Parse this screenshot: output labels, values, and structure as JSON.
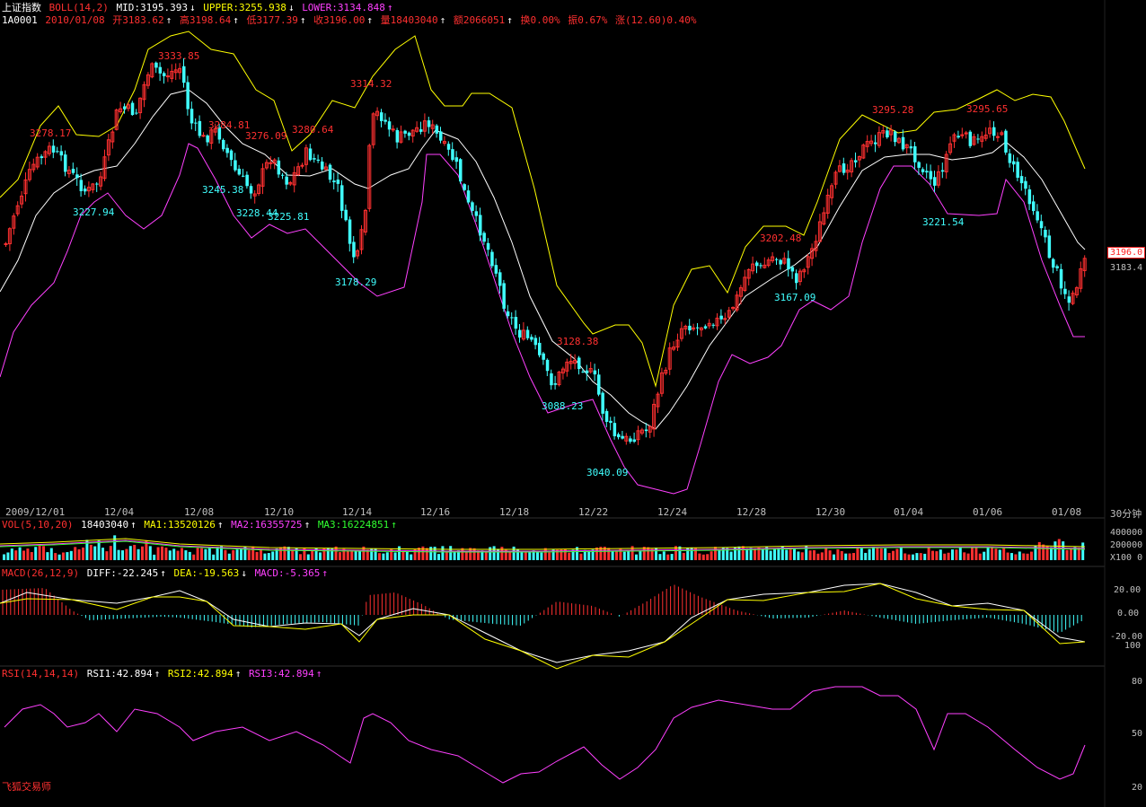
{
  "window": {
    "index_name": "上证指数",
    "code": "1A0001",
    "watermark": "飞狐交易师"
  },
  "boll": {
    "label": "BOLL(14,2)",
    "mid": "MID:3195.393",
    "mid_arrow": "↓",
    "upper": "UPPER:3255.938",
    "upper_arrow": "↓",
    "lower": "LOWER:3134.848",
    "lower_arrow": "↑"
  },
  "bar_info": {
    "date": "2010/01/08",
    "open": "开3183.62",
    "open_arrow": "↑",
    "high": "高3198.64",
    "high_arrow": "↑",
    "low": "低3177.39",
    "low_arrow": "↑",
    "close": "收3196.00",
    "close_arrow": "↑",
    "volume": "量18403040",
    "volume_arrow": "↑",
    "amount": "额2066051",
    "amount_arrow": "↑",
    "turnover": "换0.00%",
    "amplitude": "振0.67%",
    "change": "涨(12.60)0.40%"
  },
  "price_axis": {
    "current": "3196.0",
    "second": "3183.4"
  },
  "peak_labels": [
    {
      "text": "3333.85",
      "color": "#ff3030"
    },
    {
      "text": "3278.17",
      "color": "#ff3030"
    },
    {
      "text": "3284.81",
      "color": "#ff3030"
    },
    {
      "text": "3276.09",
      "color": "#ff3030"
    },
    {
      "text": "3280.64",
      "color": "#ff3030"
    },
    {
      "text": "3314.32",
      "color": "#ff3030"
    },
    {
      "text": "3128.38",
      "color": "#ff3030"
    },
    {
      "text": "3202.48",
      "color": "#ff3030"
    },
    {
      "text": "3295.28",
      "color": "#ff3030"
    },
    {
      "text": "3295.65",
      "color": "#ff3030"
    },
    {
      "text": "3227.94",
      "color": "#40ffff"
    },
    {
      "text": "3245.38",
      "color": "#40ffff"
    },
    {
      "text": "3228.44",
      "color": "#40ffff"
    },
    {
      "text": "3225.81",
      "color": "#40ffff"
    },
    {
      "text": "3178.29",
      "color": "#40ffff"
    },
    {
      "text": "3088.23",
      "color": "#40ffff"
    },
    {
      "text": "3040.09",
      "color": "#40ffff"
    },
    {
      "text": "3167.09",
      "color": "#40ffff"
    },
    {
      "text": "3221.54",
      "color": "#40ffff"
    }
  ],
  "date_axis": {
    "labels": [
      "2009/12/01",
      "12/04",
      "12/08",
      "12/10",
      "12/14",
      "12/16",
      "12/18",
      "12/22",
      "12/24",
      "12/28",
      "12/30",
      "01/04",
      "01/06",
      "01/08"
    ],
    "period": "30分钟"
  },
  "vol": {
    "label": "VOL(5,10,20)",
    "value": "18403040",
    "value_arrow": "↑",
    "ma1": "MA1:13520126",
    "ma1_arrow": "↑",
    "ma2": "MA2:16355725",
    "ma2_arrow": "↑",
    "ma3": "MA3:16224851",
    "ma3_arrow": "↑",
    "axis": [
      "400000",
      "200000",
      "X100  0"
    ]
  },
  "macd": {
    "label": "MACD(26,12,9)",
    "diff": "DIFF:-22.245",
    "diff_arrow": "↑",
    "dea": "DEA:-19.563",
    "dea_arrow": "↓",
    "macd": "MACD:-5.365",
    "macd_arrow": "↑",
    "axis": [
      "20.00",
      "0.00",
      "-20.00",
      "100"
    ]
  },
  "rsi": {
    "label": "RSI(14,14,14)",
    "rsi1": "RSI1:42.894",
    "rsi1_arrow": "↑",
    "rsi2": "RSI2:42.894",
    "rsi2_arrow": "↑",
    "rsi3": "RSI3:42.894",
    "rsi3_arrow": "↑",
    "axis": [
      "80",
      "50",
      "20"
    ]
  },
  "colors": {
    "up": "#ff3030",
    "down": "#40ffff",
    "upper": "#ffff00",
    "mid": "#ffffff",
    "lower": "#ff40ff",
    "ma_green": "#30ff30"
  }
}
